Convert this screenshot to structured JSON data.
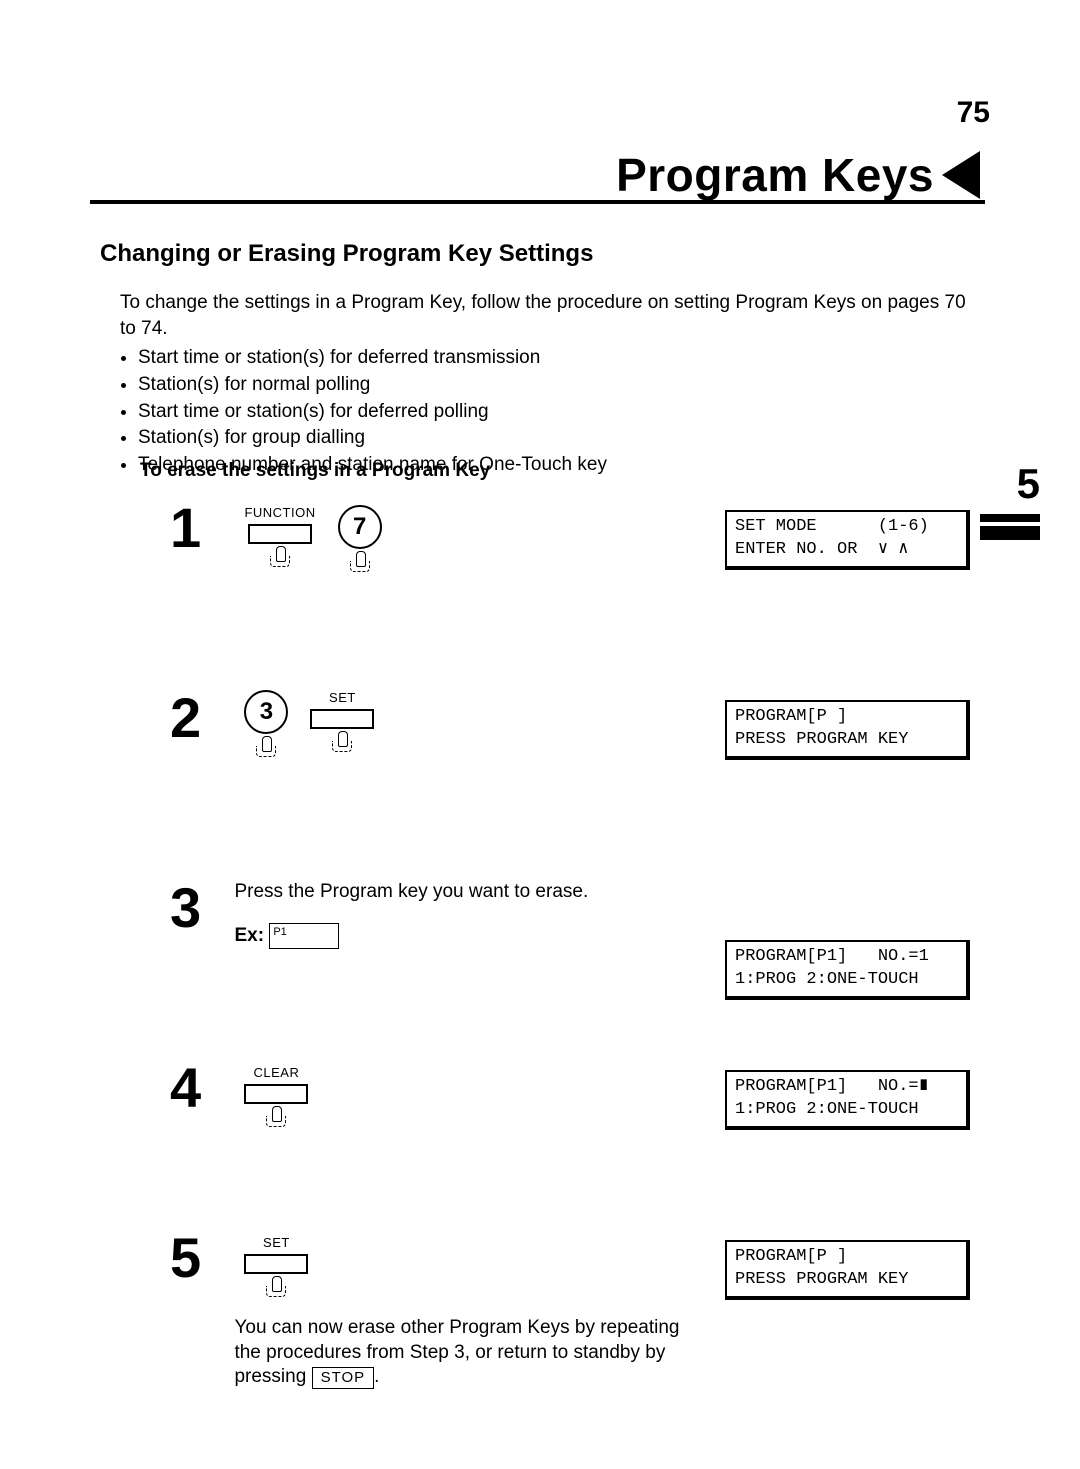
{
  "header": {
    "title": "Program Keys"
  },
  "section": {
    "title": "Changing or Erasing Program Key Settings"
  },
  "intro": {
    "lead": "To change the settings in a Program Key, follow the procedure on setting Program Keys on pages 70 to 74.",
    "bullets": [
      "Start time or station(s) for deferred transmission",
      "Station(s) for normal polling",
      "Start time or station(s) for deferred polling",
      "Station(s) for group dialling",
      "Telephone number and station name for One-Touch key"
    ]
  },
  "subhead": "To erase the settings in a Program Key",
  "sidebar": {
    "chapter": "5"
  },
  "steps": {
    "s1": {
      "num": "1",
      "btn_function": "FUNCTION",
      "btn_seven": "7",
      "lcd_l1": "SET MODE      (1-6)",
      "lcd_l2": "ENTER NO. OR  ∨ ∧"
    },
    "s2": {
      "num": "2",
      "btn_three": "3",
      "btn_set": "SET",
      "lcd_l1": "PROGRAM[P ]",
      "lcd_l2": "PRESS PROGRAM KEY"
    },
    "s3": {
      "num": "3",
      "text": "Press the Program key you want to erase.",
      "ex_label": "Ex:",
      "ex_key": "P1",
      "lcd_l1": "PROGRAM[P1]   NO.=1",
      "lcd_l2": "1:PROG 2:ONE-TOUCH"
    },
    "s4": {
      "num": "4",
      "btn_clear": "CLEAR",
      "lcd_l1": "PROGRAM[P1]   NO.=∎",
      "lcd_l2": "1:PROG 2:ONE-TOUCH"
    },
    "s5": {
      "num": "5",
      "btn_set": "SET",
      "text": "You can now erase other Program Keys by repeating the procedures from Step 3, or return to standby by pressing",
      "stop": "STOP",
      "period": ".",
      "lcd_l1": "PROGRAM[P ]",
      "lcd_l2": "PRESS PROGRAM KEY"
    }
  },
  "page_number": "75"
}
